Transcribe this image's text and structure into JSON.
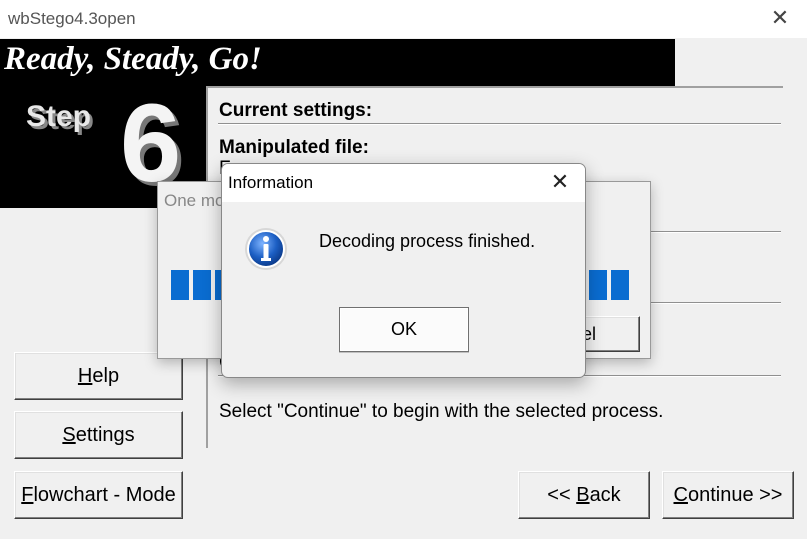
{
  "window": {
    "title": "wbStego4.3open",
    "close_glyph": "✕"
  },
  "banner": {
    "text": "Ready, Steady, Go!",
    "step_label": "Step",
    "step_number": "6"
  },
  "panel": {
    "current_settings_label": "Current settings:",
    "manipulated_file_label": "Manipulated file:",
    "partial_value": "F",
    "partial_label": "C",
    "instruction": "Select \"Continue\" to begin with the selected process."
  },
  "sidebar": {
    "help": {
      "before": "",
      "underlined": "H",
      "after": "elp"
    },
    "settings": {
      "before": "",
      "underlined": "S",
      "after": "ettings"
    },
    "flowchart": {
      "before": "",
      "underlined": "F",
      "after": "lowchart - Mode"
    }
  },
  "nav": {
    "back": {
      "before": "<< ",
      "underlined": "B",
      "after": "ack"
    },
    "continue": {
      "before": "",
      "underlined": "C",
      "after": "ontinue >>"
    }
  },
  "progress_dialog": {
    "title_partial": "One mo",
    "cancel_partial": "el",
    "progress_fraction": 1.0
  },
  "info_dialog": {
    "title": "Information",
    "close_glyph": "✕",
    "message": "Decoding process finished.",
    "ok_label": "OK",
    "icon": "info-icon",
    "icon_color": "#1c5fc4"
  }
}
